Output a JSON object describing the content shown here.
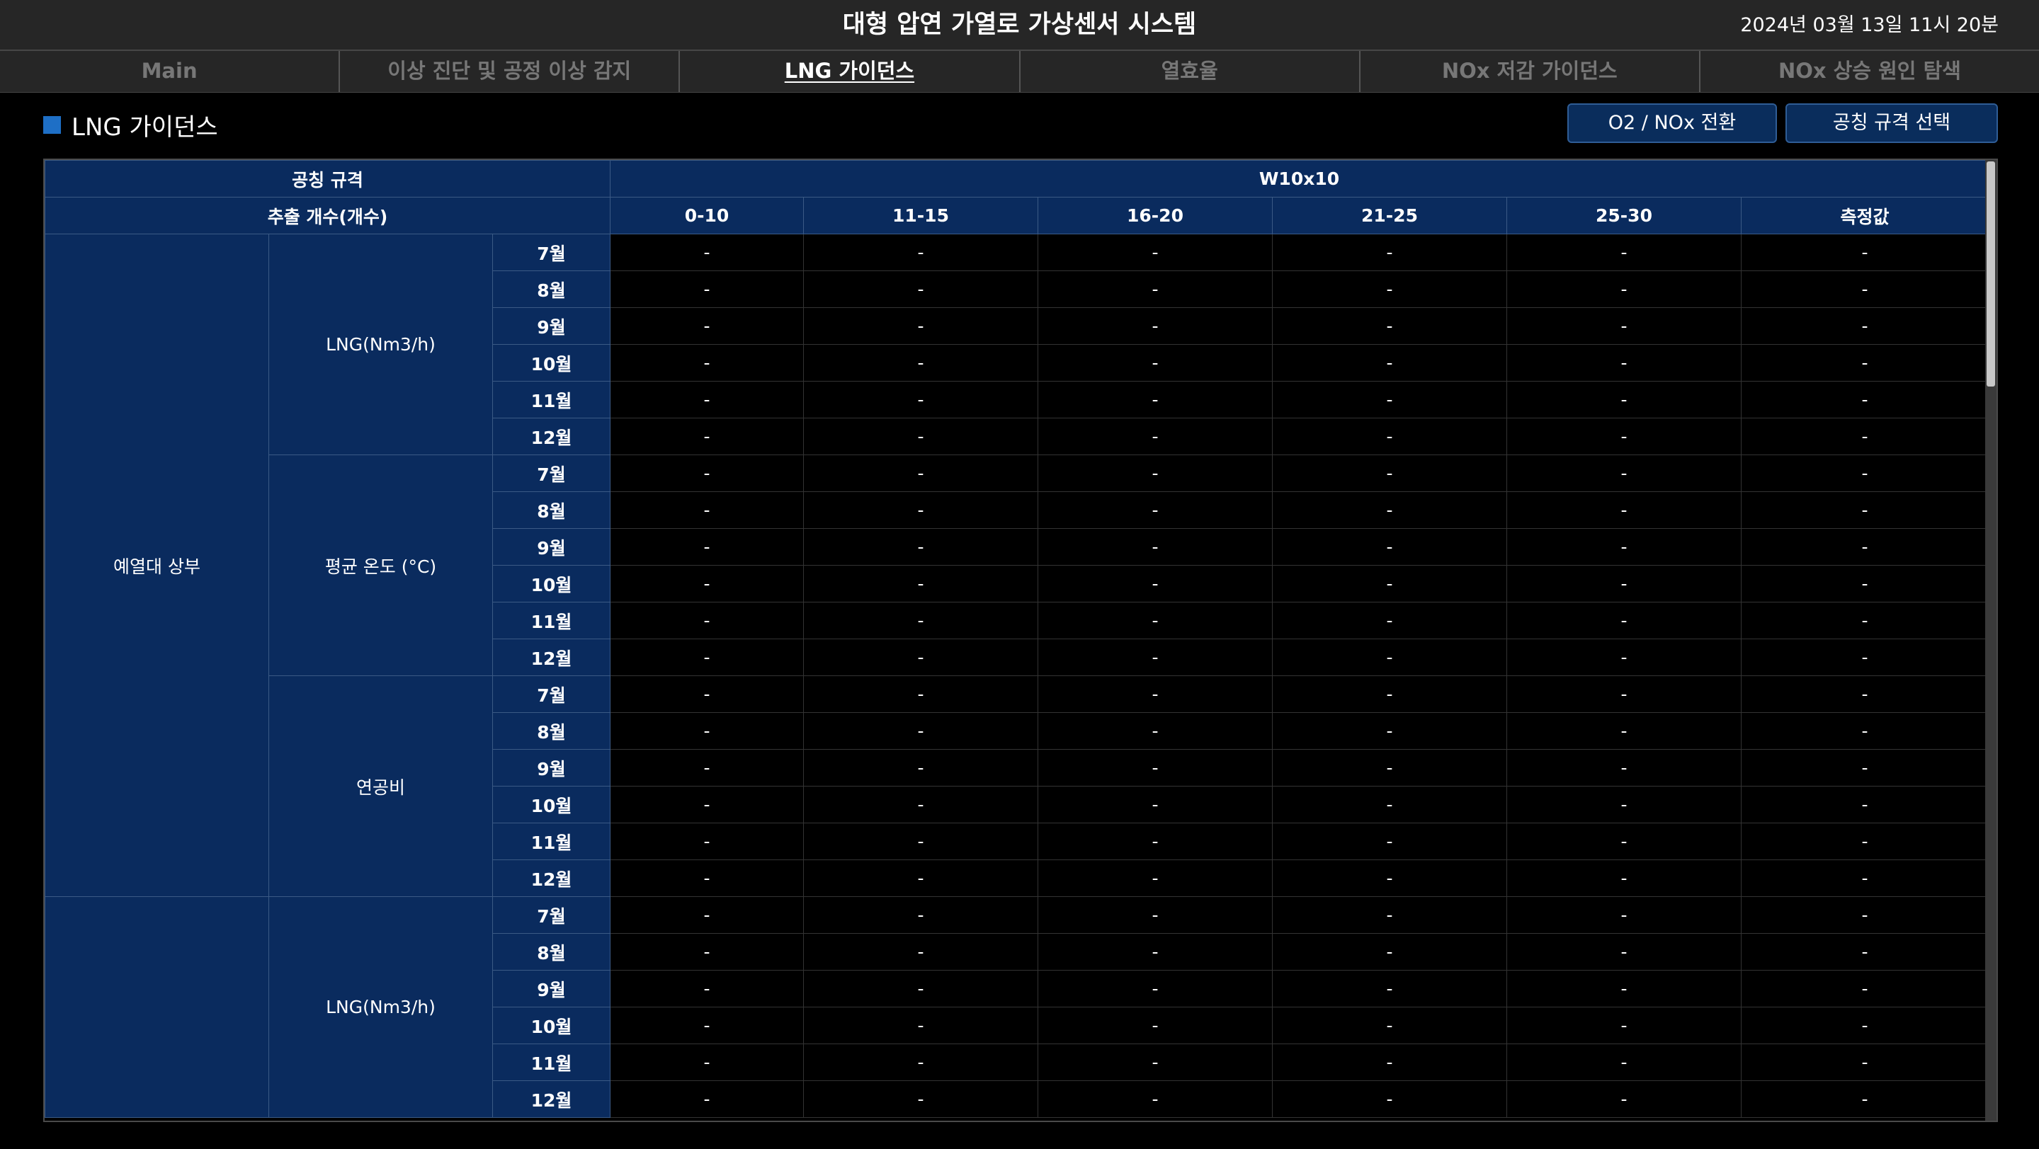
{
  "header": {
    "title": "대형 압연 가열로 가상센서 시스템",
    "datetime": "2024년 03월 13일 11시 20분"
  },
  "nav": {
    "tabs": [
      {
        "label": "Main",
        "active": false
      },
      {
        "label": "이상 진단 및 공정 이상 감지",
        "active": false
      },
      {
        "label": "LNG 가이던스",
        "active": true
      },
      {
        "label": "열효율",
        "active": false
      },
      {
        "label": "NOx 저감 가이던스",
        "active": false
      },
      {
        "label": "NOx 상승 원인 탐색",
        "active": false
      }
    ]
  },
  "section": {
    "title": "LNG 가이던스",
    "o2_nox_button": "O2 / NOx 전환",
    "spec_button": "공칭 규격 선택"
  },
  "table": {
    "spec_header": "공칭 규격",
    "spec_value": "W10x10",
    "count_header": "추출 개수(개수)",
    "columns": [
      "0-10",
      "11-15",
      "16-20",
      "21-25",
      "25-30",
      "측정값"
    ],
    "empty_value": "-",
    "zones": [
      {
        "zone": "예열대 상부",
        "metrics": [
          {
            "metric": "LNG(Nm3/h)",
            "months": [
              "7월",
              "8월",
              "9월",
              "10월",
              "11월",
              "12월"
            ]
          },
          {
            "metric": "평균 온도 (°C)",
            "months": [
              "7월",
              "8월",
              "9월",
              "10월",
              "11월",
              "12월"
            ]
          },
          {
            "metric": "연공비",
            "months": [
              "7월",
              "8월",
              "9월",
              "10월",
              "11월",
              "12월"
            ]
          }
        ]
      },
      {
        "zone": "",
        "metrics": [
          {
            "metric": "LNG(Nm3/h)",
            "months": [
              "7월",
              "8월",
              "9월",
              "10월",
              "11월",
              "12월"
            ]
          }
        ]
      }
    ]
  },
  "colors": {
    "header_bg": "#262626",
    "table_header_bg": "#0a2b5e",
    "accent_square": "#1e6fc6",
    "button_bg": "#0a2d5c"
  }
}
